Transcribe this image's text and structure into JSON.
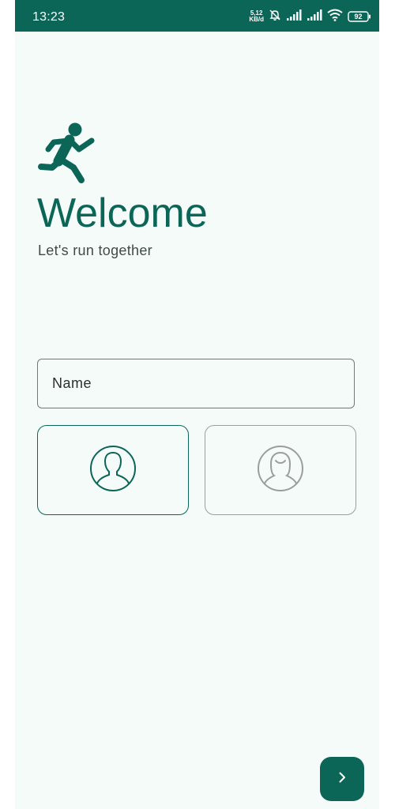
{
  "status_bar": {
    "time": "13:23",
    "network_speed_value": "5,12",
    "network_speed_unit": "KB/d",
    "battery_level": "92",
    "icons": [
      "mute-bell-icon",
      "signal-icon",
      "signal-icon",
      "wifi-icon",
      "battery-icon"
    ]
  },
  "welcome": {
    "icon": "running-person-icon",
    "title": "Welcome",
    "subtitle": "Let's run together"
  },
  "form": {
    "name_placeholder": "Name",
    "name_value": "",
    "gender_options": [
      {
        "icon": "male-avatar-icon",
        "selected": true
      },
      {
        "icon": "female-avatar-icon",
        "selected": false
      }
    ]
  },
  "actions": {
    "next_icon": "chevron-right-icon"
  },
  "colors": {
    "primary": "#0b6657",
    "background": "#f5fbf9",
    "unselected_outline": "#9a9f9d"
  }
}
